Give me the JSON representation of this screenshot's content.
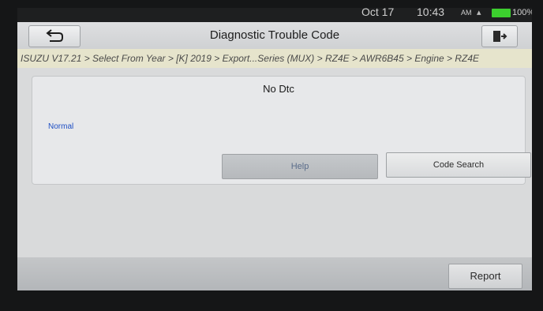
{
  "statusbar": {
    "date": "Oct 17",
    "time": "10:43",
    "ampm": "AM",
    "battery_pct": "100%",
    "battery_level": 1.0,
    "battery_color": "#3ccf2e"
  },
  "header": {
    "title": "Diagnostic Trouble Code",
    "back_icon": "back-arrow-icon",
    "exit_icon": "exit-door-icon"
  },
  "breadcrumb": "ISUZU V17.21 > Select From Year > [K] 2019 > Export...Series (MUX) > RZ4E > AWR6B45 > Engine > RZ4E",
  "result": {
    "message": "No Dtc",
    "status": "Normal",
    "status_color": "#1f4fc4"
  },
  "buttons": {
    "help": "Help",
    "code_search": "Code Search",
    "report": "Report"
  }
}
